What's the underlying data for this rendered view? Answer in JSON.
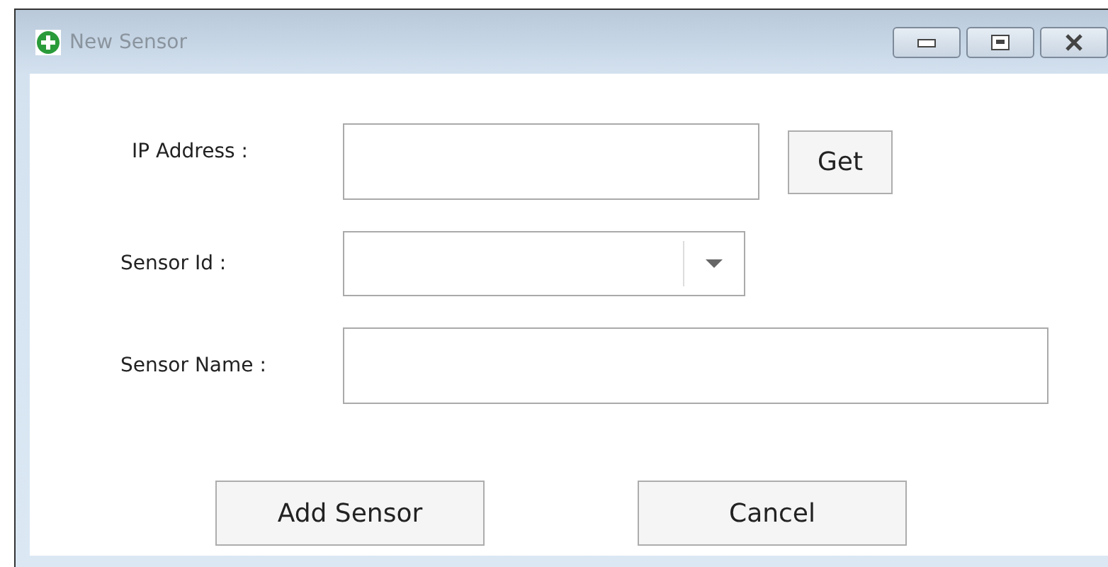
{
  "window": {
    "title": "New Sensor"
  },
  "fields": [
    {
      "kind": "text",
      "label": "IP Address :"
    },
    {
      "kind": "combo",
      "label": "Sensor Id :"
    },
    {
      "kind": "text",
      "label": "Sensor Name :"
    }
  ],
  "get_button": "Get",
  "buttons": [
    "Add Sensor",
    "Cancel"
  ]
}
